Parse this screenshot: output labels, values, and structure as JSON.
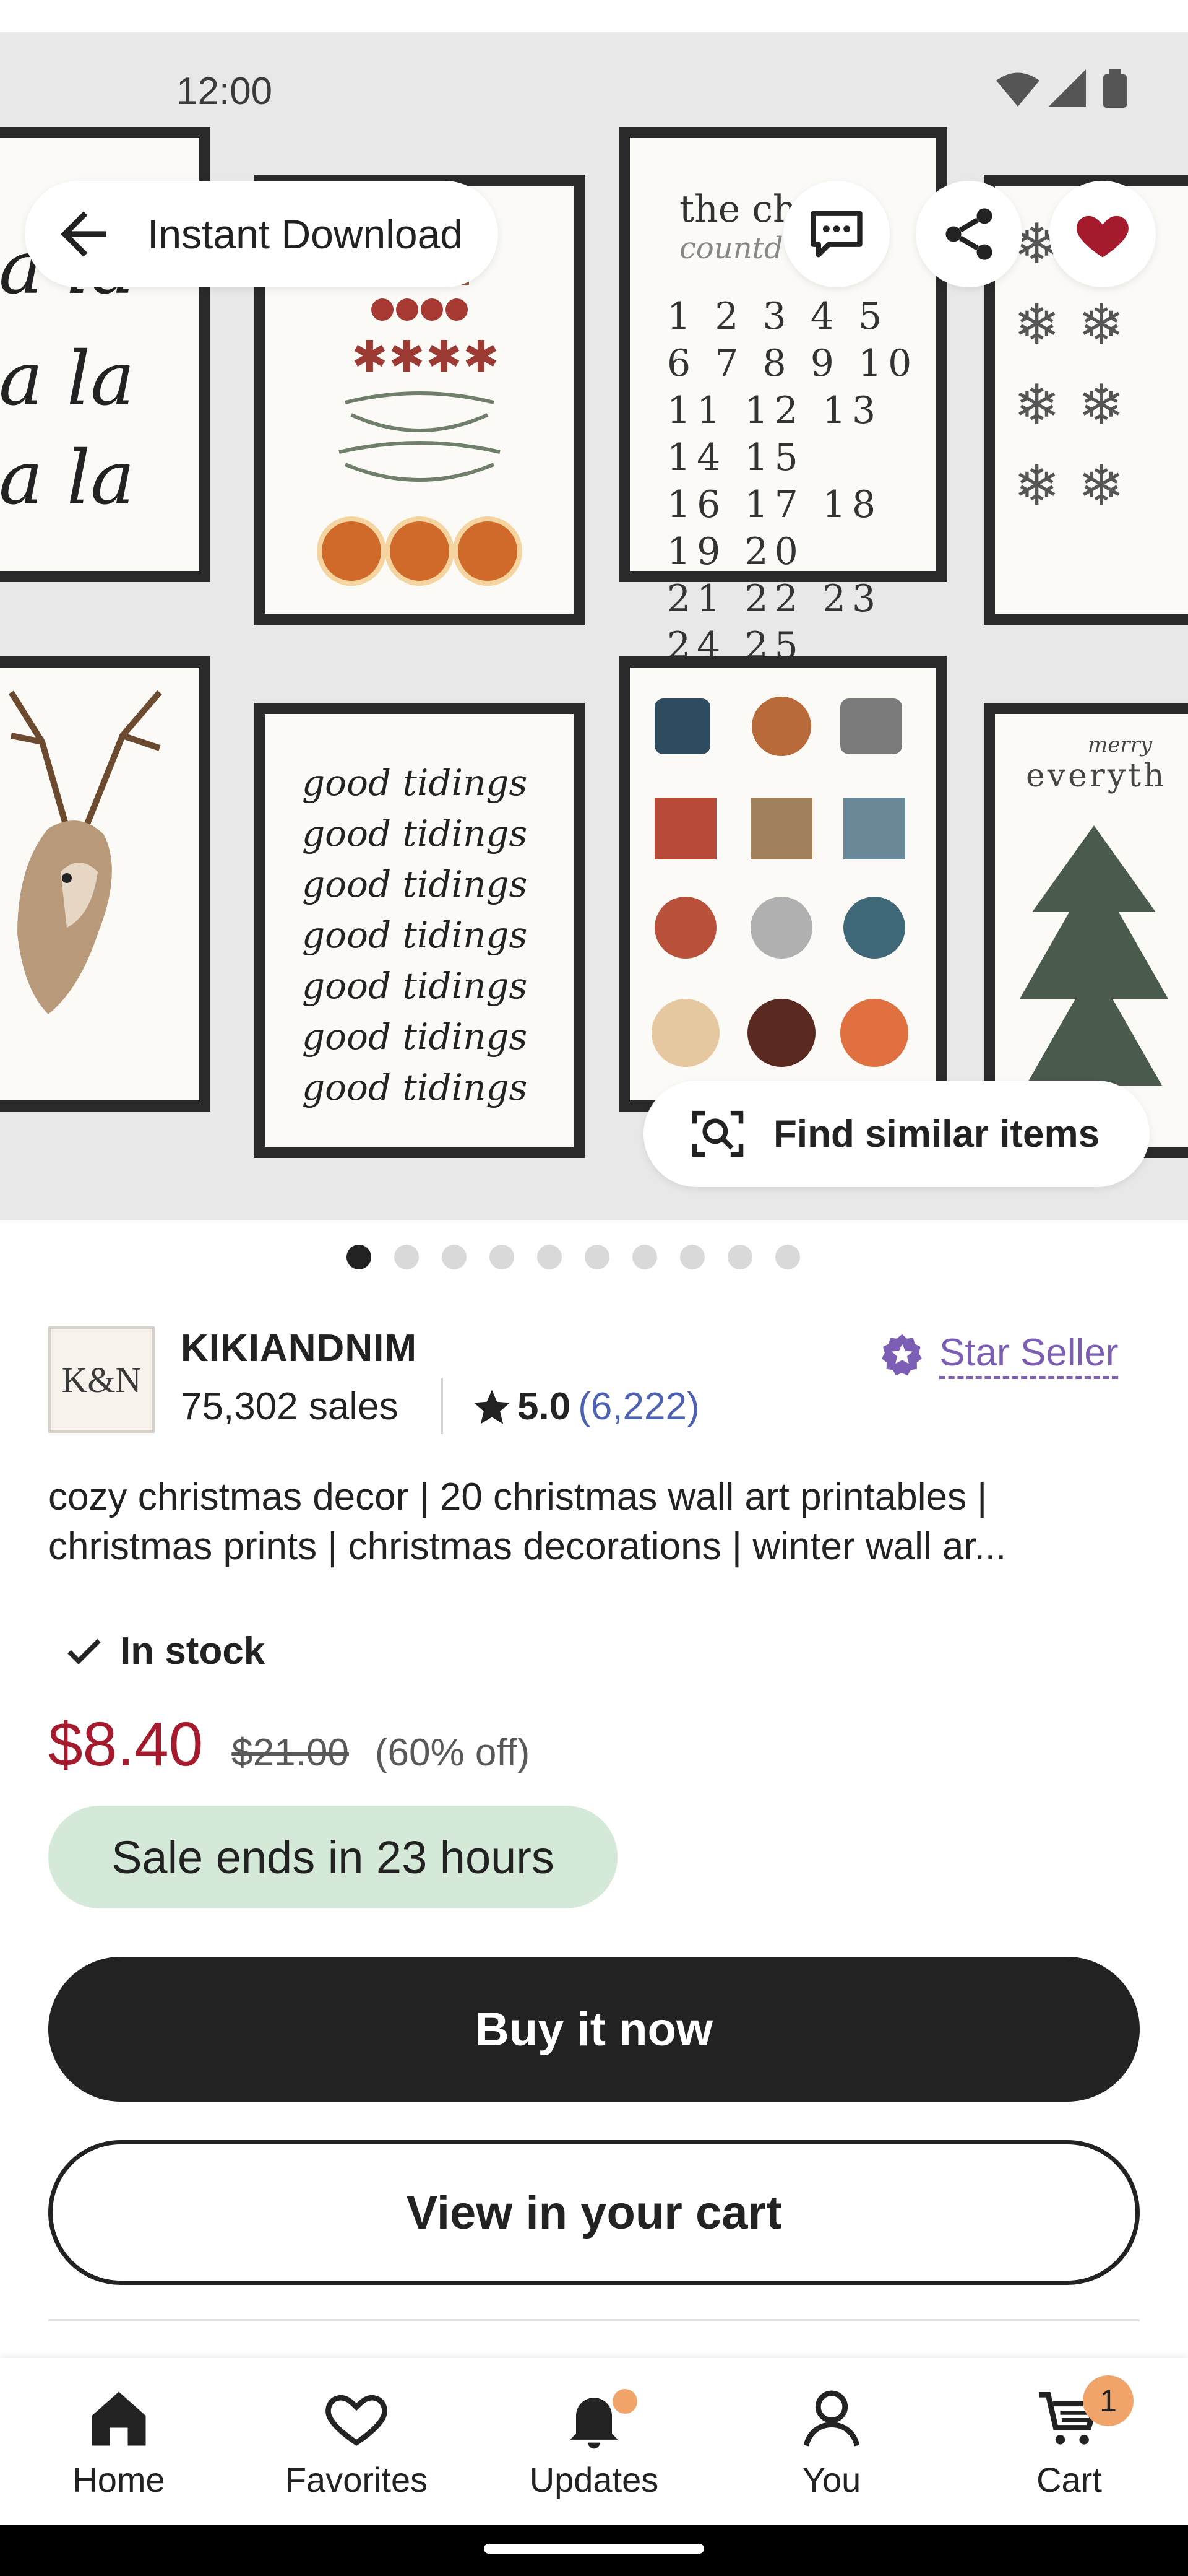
{
  "status_bar": {
    "time": "12:00"
  },
  "header": {
    "back_label": "Instant Download"
  },
  "hero": {
    "find_similar_label": "Find similar items",
    "frame_texts": {
      "lala": [
        "a la",
        "a la",
        "a la"
      ],
      "calendar_title": "the chri  s",
      "calendar_sub": "countd",
      "calendar_rows": [
        "1 2 3 4 5",
        "6 7 8 9 10",
        "11 12 13 14 15",
        "16 17 18 19 20",
        "21 22 23 24 25"
      ],
      "tidings": [
        "good tidings",
        "good tidings",
        "good tidings",
        "good tidings",
        "good tidings",
        "good tidings",
        "good tidings"
      ],
      "merry_top": "merry",
      "everything": "everyth"
    },
    "page_count": 10,
    "active_page": 1
  },
  "shop": {
    "logo_text": "K&N",
    "logo_sub": "",
    "name": "KIKIANDNIM",
    "sales": "75,302 sales",
    "rating": "5.0",
    "review_count": "(6,222)",
    "star_seller_label": "Star Seller"
  },
  "listing": {
    "title_line1": "cozy christmas decor | 20 christmas wall art printables |",
    "title_line2": "christmas prints | christmas decorations | winter wall ar...",
    "stock_label": "In stock",
    "price": "$8.40",
    "original_price": "$21.00",
    "discount": "(60% off)",
    "sale_banner": "Sale ends in 23 hours",
    "buy_now_label": "Buy it now",
    "view_cart_label": "View in your cart"
  },
  "bottom_nav": {
    "items": [
      {
        "label": "Home",
        "icon": "home-icon"
      },
      {
        "label": "Favorites",
        "icon": "heart-icon"
      },
      {
        "label": "Updates",
        "icon": "bell-icon"
      },
      {
        "label": "You",
        "icon": "person-icon"
      },
      {
        "label": "Cart",
        "icon": "cart-icon"
      }
    ],
    "cart_count": "1"
  },
  "colors": {
    "accent_price": "#a61a2e",
    "star_seller": "#7c5fb4",
    "review_link": "#4d62b3",
    "sale_banner_bg": "#d4e9d7",
    "favorite_heart": "#a61a2e",
    "notification": "#f1a46a"
  }
}
